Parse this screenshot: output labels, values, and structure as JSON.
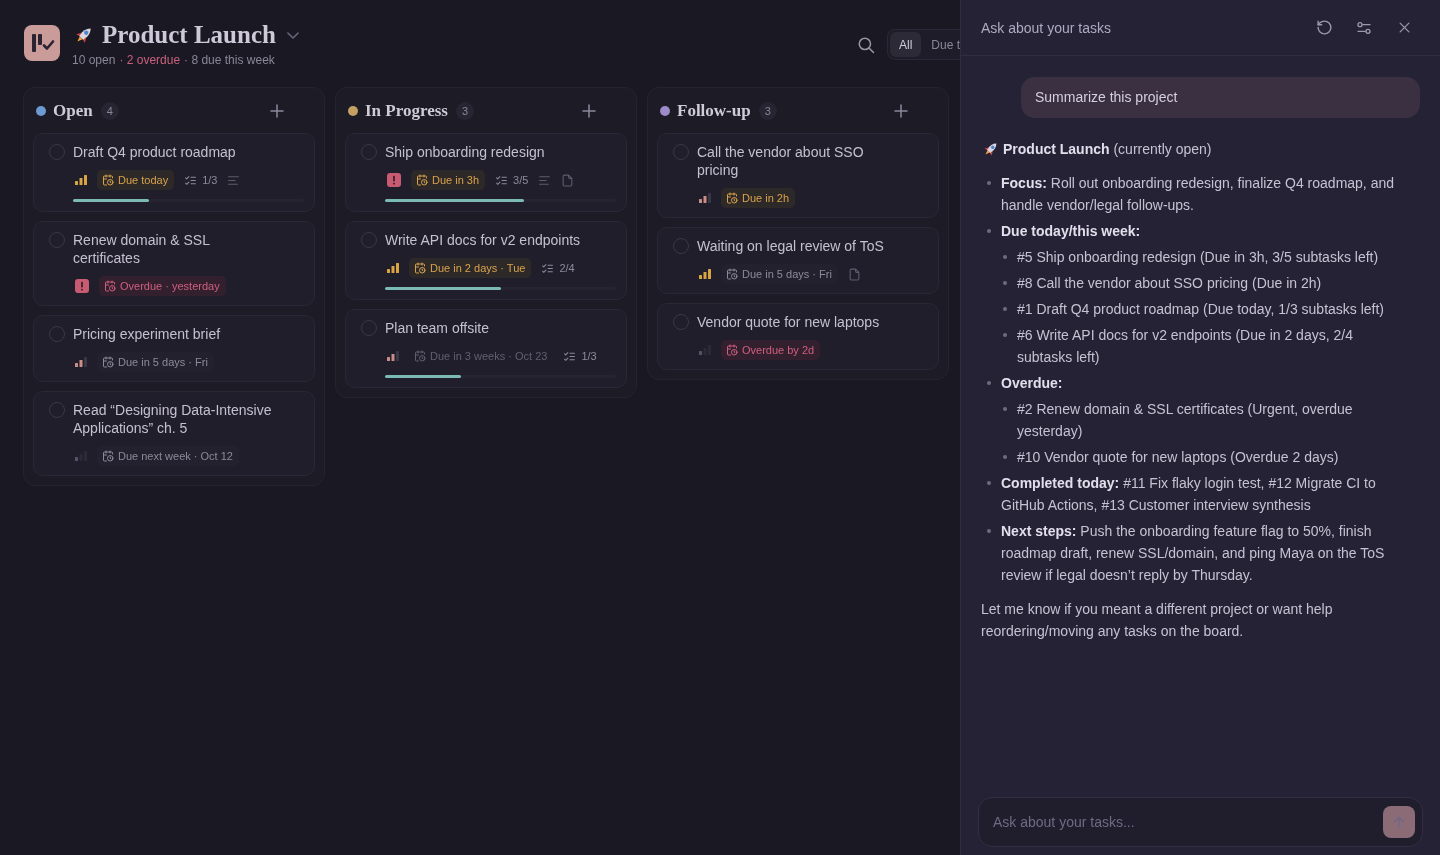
{
  "header": {
    "title": "Product Launch",
    "stats": [
      {
        "text": "10 open",
        "color": "#8a8699"
      },
      {
        "text": "· 2 overdue",
        "color": "#c9607c"
      },
      {
        "text": "· 8 due this week",
        "color": "#8a8699"
      }
    ]
  },
  "filters": [
    {
      "label": "All",
      "selected": true
    },
    {
      "label": "Due t",
      "selected": false
    }
  ],
  "columns": [
    {
      "name": "Open",
      "color": "#6b9bd1",
      "count": "4",
      "cards": [
        {
          "title": "Draft Q4 product roadmap",
          "done": false,
          "priority": {
            "kind": "high"
          },
          "due": {
            "text": "Due today",
            "kind": "warning"
          },
          "subtasks": "1/3",
          "notes": true,
          "attachment": false,
          "level": 0.33
        },
        {
          "title": "Renew domain & SSL certificates",
          "done": false,
          "priority": {
            "kind": "urgent"
          },
          "due": {
            "text": "Overdue · yesterday",
            "kind": "danger"
          },
          "notes": false,
          "attachment": false
        },
        {
          "title": "Pricing experiment brief",
          "done": false,
          "priority": {
            "kind": "medium"
          },
          "due": {
            "text": "Due in 5 days · Fri",
            "kind": "neutral"
          },
          "notes": false,
          "attachment": false
        },
        {
          "title": "Read “Designing Data-Intensive Applications” ch. 5",
          "done": false,
          "priority": {
            "kind": "low"
          },
          "due": {
            "text": "Due next week · Oct 12",
            "kind": "neutral"
          },
          "notes": false,
          "attachment": false
        }
      ]
    },
    {
      "name": "In Progress",
      "color": "#c4a062",
      "count": "3",
      "cards": [
        {
          "title": "Ship onboarding redesign",
          "done": false,
          "priority": {
            "kind": "urgent"
          },
          "due": {
            "text": "Due in 3h",
            "kind": "warning"
          },
          "subtasks": "3/5",
          "notes": true,
          "attachment": true,
          "level": 0.6
        },
        {
          "title": "Write API docs for v2 endpoints",
          "done": false,
          "priority": {
            "kind": "high"
          },
          "due": {
            "text": "Due in 2 days · Tue",
            "kind": "warning"
          },
          "subtasks": "2/4",
          "notes": false,
          "attachment": false,
          "level": 0.5
        },
        {
          "title": "Plan team offsite",
          "done": false,
          "priority": {
            "kind": "medium"
          },
          "due": {
            "text": "Due in 3 weeks · Oct 23",
            "kind": "muted"
          },
          "subtasks": "1/3",
          "notes": false,
          "attachment": false,
          "level": 0.33
        }
      ]
    },
    {
      "name": "Follow-up",
      "color": "#9d8bc9",
      "count": "3",
      "cards": [
        {
          "title": "Call the vendor about SSO pricing",
          "done": false,
          "priority": {
            "kind": "medium"
          },
          "due": {
            "text": "Due in 2h",
            "kind": "warning"
          },
          "notes": false,
          "attachment": false
        },
        {
          "title": "Waiting on legal review of ToS",
          "done": false,
          "priority": {
            "kind": "high"
          },
          "due": {
            "text": "Due in 5 days · Fri",
            "kind": "neutral"
          },
          "notes": false,
          "attachment": true
        },
        {
          "title": "Vendor quote for new laptops",
          "done": false,
          "priority": {
            "kind": "low"
          },
          "due": {
            "text": "Overdue by 2d",
            "kind": "danger"
          },
          "notes": false,
          "attachment": false
        }
      ]
    }
  ],
  "chat": {
    "title": "Ask about your tasks",
    "user_message": "Summarize this project",
    "reply": {
      "heading": {
        "label": "Product Launch",
        "text": "(currently open)"
      },
      "bullets": [
        {
          "label": "Focus:",
          "text": "Roll out onboarding redesign, finalize Q4 roadmap, and handle vendor/legal follow-ups."
        },
        {
          "label": "Due today/this week:",
          "children": [
            "#5 Ship onboarding redesign (Due in 3h, 3/5 subtasks left)",
            "#8 Call the vendor about SSO pricing (Due in 2h)",
            "#1 Draft Q4 product roadmap (Due today, 1/3 subtasks left)",
            "#6 Write API docs for v2 endpoints (Due in 2 days, 2/4 subtasks left)"
          ]
        },
        {
          "label": "Overdue:",
          "children": [
            "#2 Renew domain & SSL certificates (Urgent, overdue yesterday)",
            "#10 Vendor quote for new laptops (Overdue 2 days)"
          ]
        },
        {
          "label": "Completed today:",
          "text": "#11 Fix flaky login test, #12 Migrate CI to GitHub Actions, #13 Customer interview synthesis"
        },
        {
          "label": "Next steps:",
          "text": "Push the onboarding feature flag to 50%, finish roadmap draft, renew SSL/domain, and ping Maya on the ToS review if legal doesn’t reply by Thursday."
        }
      ],
      "closing": "Let me know if you meant a different project or want help reordering/moving any tasks on the board."
    },
    "input": {
      "placeholder": "Ask about your tasks..."
    }
  }
}
